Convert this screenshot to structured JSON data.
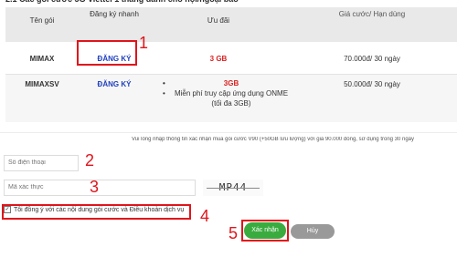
{
  "top_heading": "2.1 Các gói cước 5G Viettel 1 tháng dành cho nội/ngoại bảo",
  "table": {
    "headers": {
      "name": "Tên gói",
      "register": "Đăng ký nhanh",
      "promo": "Ưu đãi",
      "price": "Giá cước/ Hạn dùng"
    },
    "rows": [
      {
        "name": "MIMAX",
        "register": "ĐĂNG KÝ",
        "promo": "3 GB",
        "price": "70.000đ/ 30 ngày"
      },
      {
        "name": "MIMAXSV",
        "register": "ĐĂNG KÝ",
        "promo_items": [
          "3GB",
          "Miễn phí truy cập ứng dụng ONME (tối đa 3GB)"
        ],
        "price": "50.000đ/ 30 ngày"
      }
    ]
  },
  "annotations": [
    "1",
    "2",
    "3",
    "4",
    "5"
  ],
  "form": {
    "notice": "Vui lòng nhập thông tin xác nhận mua gói cước V90 (+50GB lưu lượng) với giá 90.000 đồng, sử dụng trong 30 ngày",
    "phone_placeholder": "Số điện thoại",
    "captcha_placeholder": "Mã xác thực",
    "captcha_text": "MP44",
    "agree_text": "Tôi đồng ý với các nội dung gói cước và Điều khoản dịch vụ",
    "confirm_label": "Xác nhận",
    "cancel_label": "Hủy"
  },
  "colors": {
    "annotation_red": "#e0141b",
    "link_blue": "#1f3fbf",
    "confirm_green": "#3aac3f",
    "cancel_gray": "#999999"
  }
}
